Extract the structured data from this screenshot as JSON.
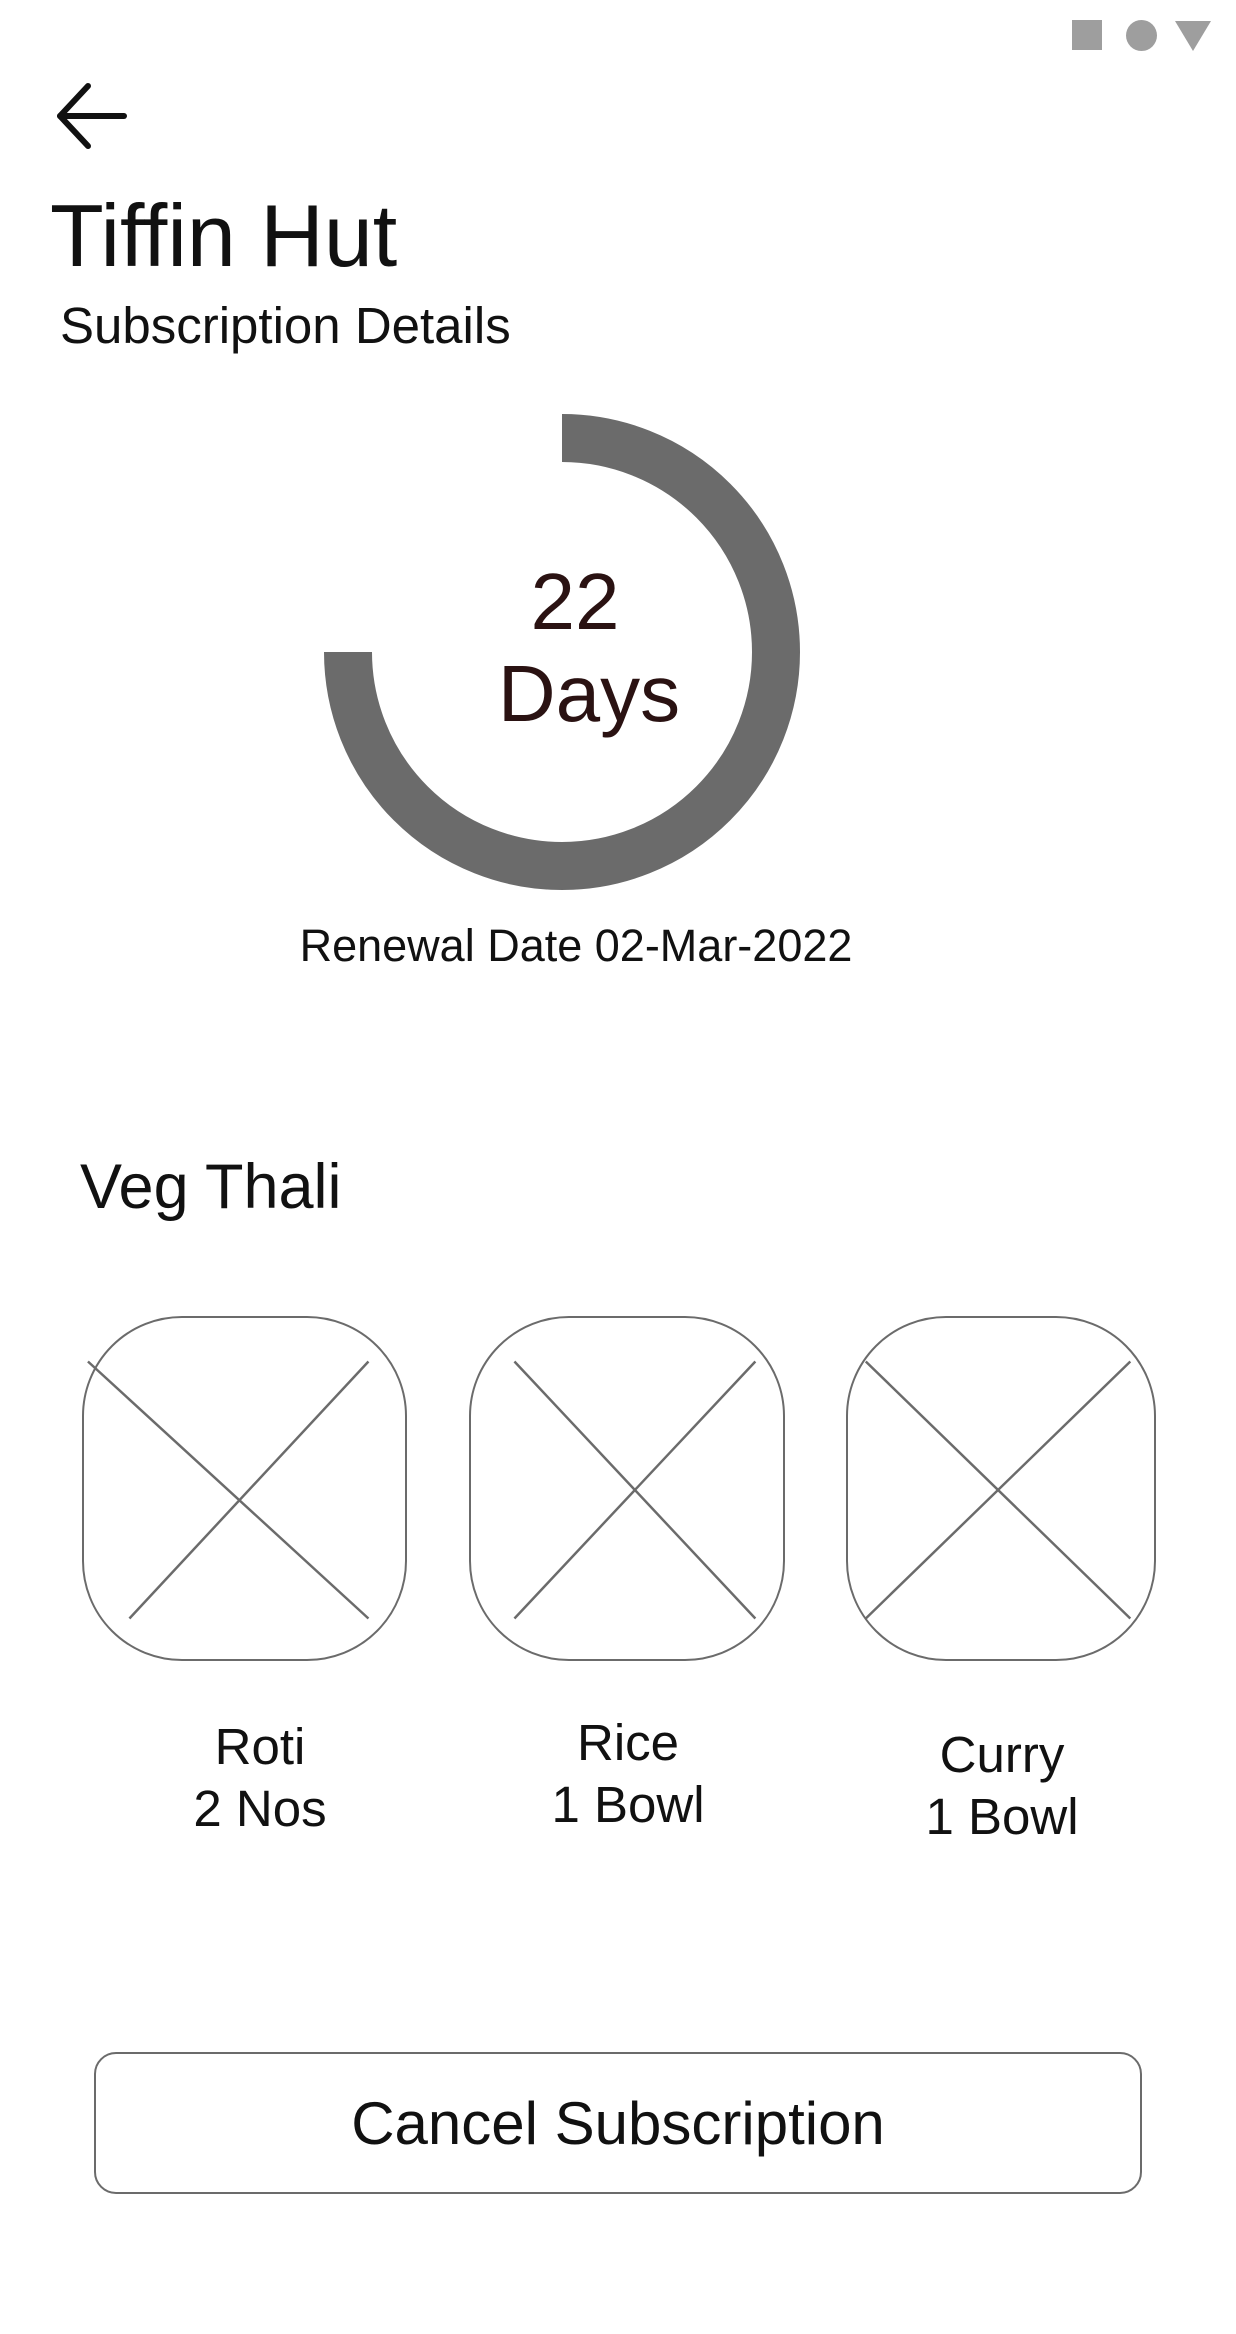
{
  "status_bar": {
    "icons": [
      "square-icon",
      "circle-icon",
      "triangle-icon"
    ],
    "icon_color": "#9e9e9e"
  },
  "header": {
    "back_icon": "arrow-left-icon",
    "title": "Tiffin Hut",
    "subtitle": "Subscription Details"
  },
  "subscription": {
    "days_remaining": "22",
    "days_label": "Days",
    "progress_fraction": 0.75,
    "ring_color": "#6b6b6b",
    "renewal_label": "Renewal Date",
    "renewal_date": "02-Mar-2022"
  },
  "meal": {
    "name": "Veg Thali",
    "items": [
      {
        "name": "Roti",
        "quantity": "2 Nos",
        "image": "image-placeholder-icon"
      },
      {
        "name": "Rice",
        "quantity": "1 Bowl",
        "image": "image-placeholder-icon"
      },
      {
        "name": "Curry",
        "quantity": "1 Bowl",
        "image": "image-placeholder-icon"
      }
    ]
  },
  "actions": {
    "cancel_label": "Cancel Subscription"
  }
}
